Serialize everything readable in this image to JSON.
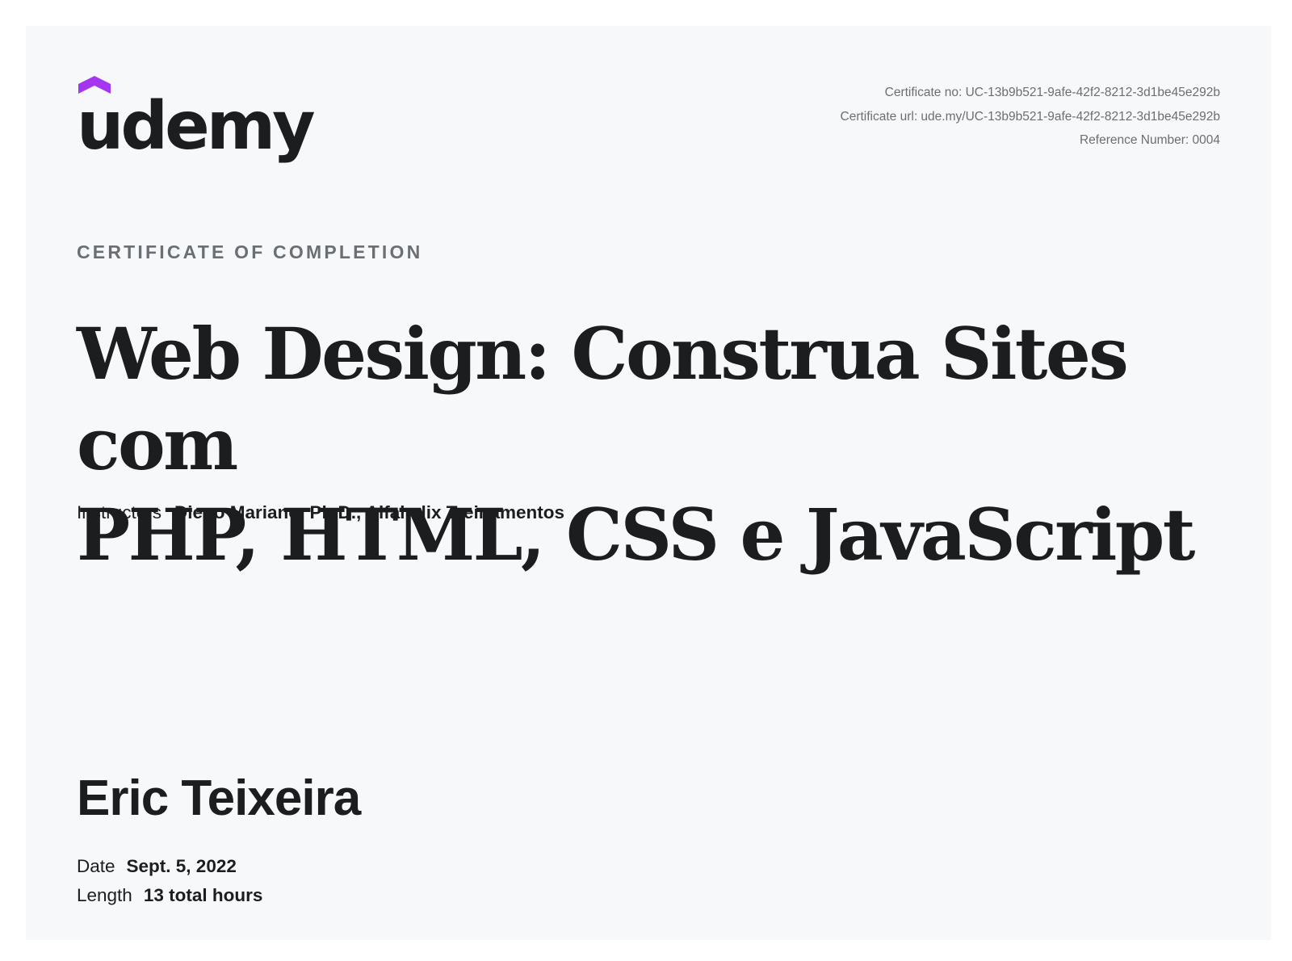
{
  "brand": {
    "name": "udemy",
    "accent_color": "#a435f0"
  },
  "meta": {
    "certificate_no": "Certificate no: UC-13b9b521-9afe-42f2-8212-3d1be45e292b",
    "certificate_url": "Certificate url: ude.my/UC-13b9b521-9afe-42f2-8212-3d1be45e292b",
    "reference_number": "Reference Number: 0004"
  },
  "eyebrow": "CERTIFICATE OF COMPLETION",
  "course": {
    "title_line1": "Web Design: Construa Sites com",
    "title_line2": "PHP, HTML, CSS e JavaScript"
  },
  "instructors": {
    "label": "Instructors",
    "names": "Diego Mariano, Ph.D.,  Alfahelix Treinamentos"
  },
  "recipient": "Eric Teixeira",
  "details": {
    "date_label": "Date",
    "date_value": "Sept. 5, 2022",
    "length_label": "Length",
    "length_value": "13 total hours"
  }
}
